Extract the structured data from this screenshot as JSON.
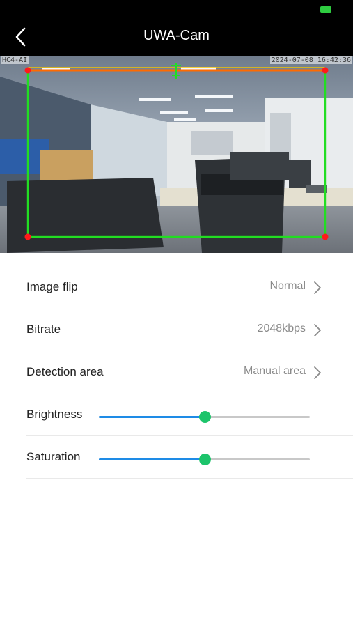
{
  "header": {
    "title": "UWA-Cam"
  },
  "video": {
    "osd_left": "HC4-AI",
    "osd_right": "2024-07-08 16:42:36",
    "colors": {
      "roi": "#22dd22",
      "top_edge": "#ff6a00",
      "corner": "#ff1a1a",
      "center_marker": "#22dd22"
    }
  },
  "settings": [
    {
      "label": "Image flip",
      "value": "Normal"
    },
    {
      "label": "Bitrate",
      "value": "2048kbps"
    },
    {
      "label": "Detection area",
      "value": "Manual area"
    }
  ],
  "sliders": [
    {
      "label": "Brightness",
      "level": 0.5
    },
    {
      "label": "Saturation",
      "level": 0.5
    }
  ],
  "colors": {
    "accent": "#1e8be6",
    "thumb": "#1dc46b",
    "battery": "#2ecc40"
  },
  "icons": {
    "back": "chevron-left-icon",
    "row_arrow": "chevron-right-icon",
    "battery": "battery-icon"
  }
}
